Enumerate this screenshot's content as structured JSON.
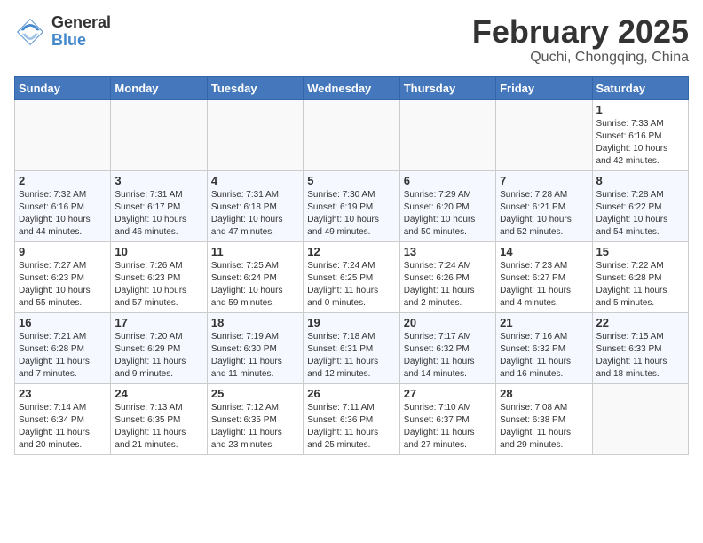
{
  "logo": {
    "general": "General",
    "blue": "Blue"
  },
  "title": "February 2025",
  "subtitle": "Quchi, Chongqing, China",
  "weekdays": [
    "Sunday",
    "Monday",
    "Tuesday",
    "Wednesday",
    "Thursday",
    "Friday",
    "Saturday"
  ],
  "weeks": [
    [
      {
        "num": "",
        "info": ""
      },
      {
        "num": "",
        "info": ""
      },
      {
        "num": "",
        "info": ""
      },
      {
        "num": "",
        "info": ""
      },
      {
        "num": "",
        "info": ""
      },
      {
        "num": "",
        "info": ""
      },
      {
        "num": "1",
        "info": "Sunrise: 7:33 AM\nSunset: 6:16 PM\nDaylight: 10 hours\nand 42 minutes."
      }
    ],
    [
      {
        "num": "2",
        "info": "Sunrise: 7:32 AM\nSunset: 6:16 PM\nDaylight: 10 hours\nand 44 minutes."
      },
      {
        "num": "3",
        "info": "Sunrise: 7:31 AM\nSunset: 6:17 PM\nDaylight: 10 hours\nand 46 minutes."
      },
      {
        "num": "4",
        "info": "Sunrise: 7:31 AM\nSunset: 6:18 PM\nDaylight: 10 hours\nand 47 minutes."
      },
      {
        "num": "5",
        "info": "Sunrise: 7:30 AM\nSunset: 6:19 PM\nDaylight: 10 hours\nand 49 minutes."
      },
      {
        "num": "6",
        "info": "Sunrise: 7:29 AM\nSunset: 6:20 PM\nDaylight: 10 hours\nand 50 minutes."
      },
      {
        "num": "7",
        "info": "Sunrise: 7:28 AM\nSunset: 6:21 PM\nDaylight: 10 hours\nand 52 minutes."
      },
      {
        "num": "8",
        "info": "Sunrise: 7:28 AM\nSunset: 6:22 PM\nDaylight: 10 hours\nand 54 minutes."
      }
    ],
    [
      {
        "num": "9",
        "info": "Sunrise: 7:27 AM\nSunset: 6:23 PM\nDaylight: 10 hours\nand 55 minutes."
      },
      {
        "num": "10",
        "info": "Sunrise: 7:26 AM\nSunset: 6:23 PM\nDaylight: 10 hours\nand 57 minutes."
      },
      {
        "num": "11",
        "info": "Sunrise: 7:25 AM\nSunset: 6:24 PM\nDaylight: 10 hours\nand 59 minutes."
      },
      {
        "num": "12",
        "info": "Sunrise: 7:24 AM\nSunset: 6:25 PM\nDaylight: 11 hours\nand 0 minutes."
      },
      {
        "num": "13",
        "info": "Sunrise: 7:24 AM\nSunset: 6:26 PM\nDaylight: 11 hours\nand 2 minutes."
      },
      {
        "num": "14",
        "info": "Sunrise: 7:23 AM\nSunset: 6:27 PM\nDaylight: 11 hours\nand 4 minutes."
      },
      {
        "num": "15",
        "info": "Sunrise: 7:22 AM\nSunset: 6:28 PM\nDaylight: 11 hours\nand 5 minutes."
      }
    ],
    [
      {
        "num": "16",
        "info": "Sunrise: 7:21 AM\nSunset: 6:28 PM\nDaylight: 11 hours\nand 7 minutes."
      },
      {
        "num": "17",
        "info": "Sunrise: 7:20 AM\nSunset: 6:29 PM\nDaylight: 11 hours\nand 9 minutes."
      },
      {
        "num": "18",
        "info": "Sunrise: 7:19 AM\nSunset: 6:30 PM\nDaylight: 11 hours\nand 11 minutes."
      },
      {
        "num": "19",
        "info": "Sunrise: 7:18 AM\nSunset: 6:31 PM\nDaylight: 11 hours\nand 12 minutes."
      },
      {
        "num": "20",
        "info": "Sunrise: 7:17 AM\nSunset: 6:32 PM\nDaylight: 11 hours\nand 14 minutes."
      },
      {
        "num": "21",
        "info": "Sunrise: 7:16 AM\nSunset: 6:32 PM\nDaylight: 11 hours\nand 16 minutes."
      },
      {
        "num": "22",
        "info": "Sunrise: 7:15 AM\nSunset: 6:33 PM\nDaylight: 11 hours\nand 18 minutes."
      }
    ],
    [
      {
        "num": "23",
        "info": "Sunrise: 7:14 AM\nSunset: 6:34 PM\nDaylight: 11 hours\nand 20 minutes."
      },
      {
        "num": "24",
        "info": "Sunrise: 7:13 AM\nSunset: 6:35 PM\nDaylight: 11 hours\nand 21 minutes."
      },
      {
        "num": "25",
        "info": "Sunrise: 7:12 AM\nSunset: 6:35 PM\nDaylight: 11 hours\nand 23 minutes."
      },
      {
        "num": "26",
        "info": "Sunrise: 7:11 AM\nSunset: 6:36 PM\nDaylight: 11 hours\nand 25 minutes."
      },
      {
        "num": "27",
        "info": "Sunrise: 7:10 AM\nSunset: 6:37 PM\nDaylight: 11 hours\nand 27 minutes."
      },
      {
        "num": "28",
        "info": "Sunrise: 7:08 AM\nSunset: 6:38 PM\nDaylight: 11 hours\nand 29 minutes."
      },
      {
        "num": "",
        "info": ""
      }
    ]
  ]
}
